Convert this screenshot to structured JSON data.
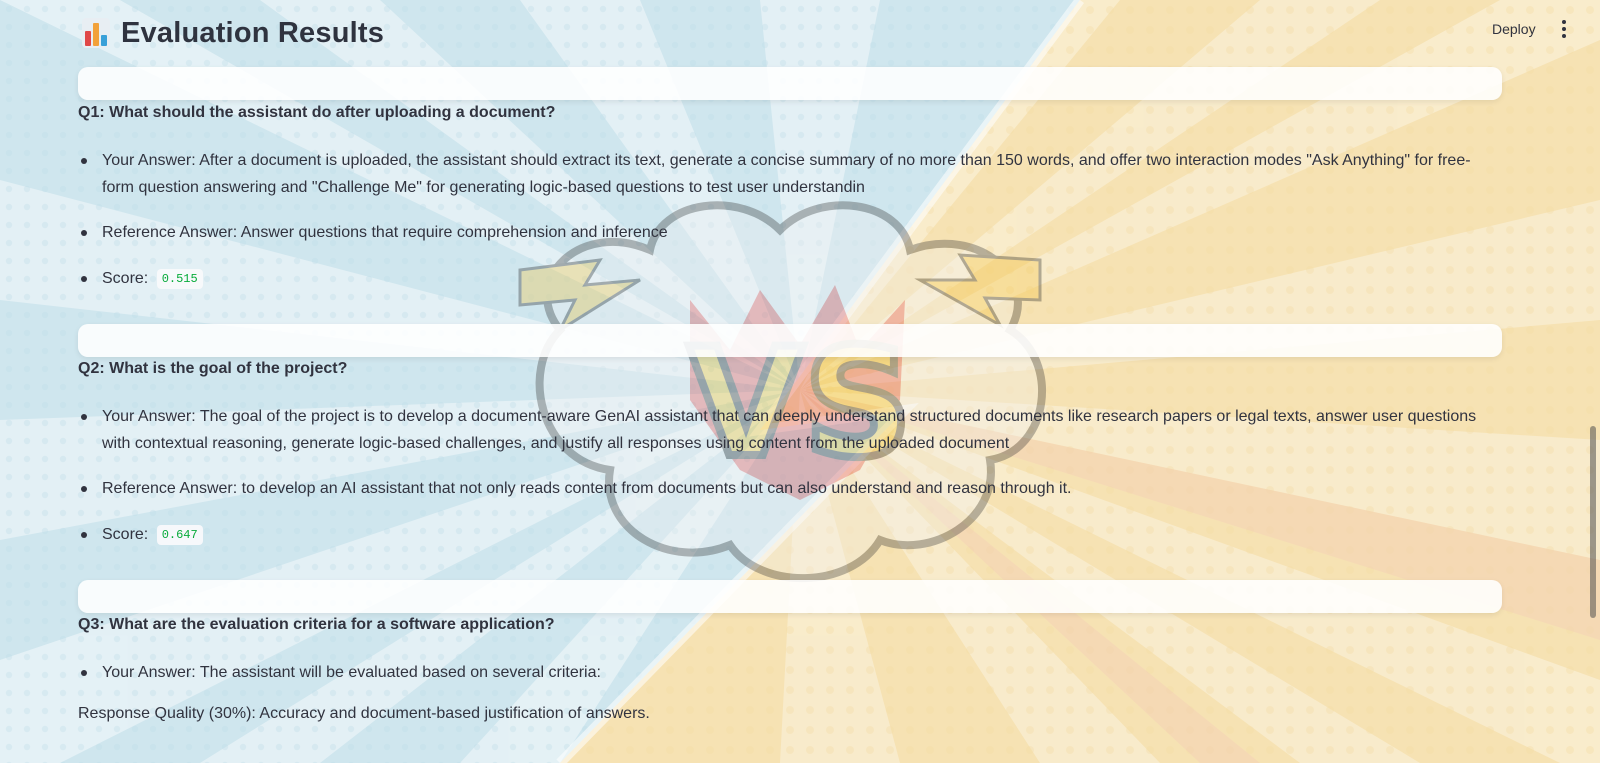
{
  "header": {
    "title": "Evaluation Results",
    "title_icon": "bar-chart-icon",
    "deploy_label": "Deploy",
    "menu_icon": "vertical-dots-icon"
  },
  "colors": {
    "text": "#31333f",
    "score_code": "#09ab3b",
    "card_bg": "#ffffff"
  },
  "results": [
    {
      "question": "Q1: What should the assistant do after uploading a document?",
      "your_answer": "Your Answer: After a document is uploaded, the assistant should extract its text, generate a concise summary of no more than 150 words, and offer two interaction modes \"Ask Anything\" for free-form question answering and \"Challenge Me\" for generating logic-based questions to test user understandin",
      "reference_answer": "Reference Answer: Answer questions that require comprehension and inference",
      "score_label": "Score:",
      "score": "0.515"
    },
    {
      "question": "Q2: What is the goal of the project?",
      "your_answer": "Your Answer: The goal of the project is to develop a document-aware GenAI assistant that can deeply understand structured documents like research papers or legal texts, answer user questions with contextual reasoning, generate logic-based challenges, and justify all responses using content from the uploaded document",
      "reference_answer": "Reference Answer: to develop an AI assistant that not only reads content from documents but can also understand and reason through it.",
      "score_label": "Score:",
      "score": "0.647"
    },
    {
      "question": "Q3: What are the evaluation criteria for a software application?",
      "your_answer": "Your Answer: The assistant will be evaluated based on several criteria:",
      "extra_paragraph": "Response Quality (30%): Accuracy and document-based justification of answers."
    }
  ]
}
